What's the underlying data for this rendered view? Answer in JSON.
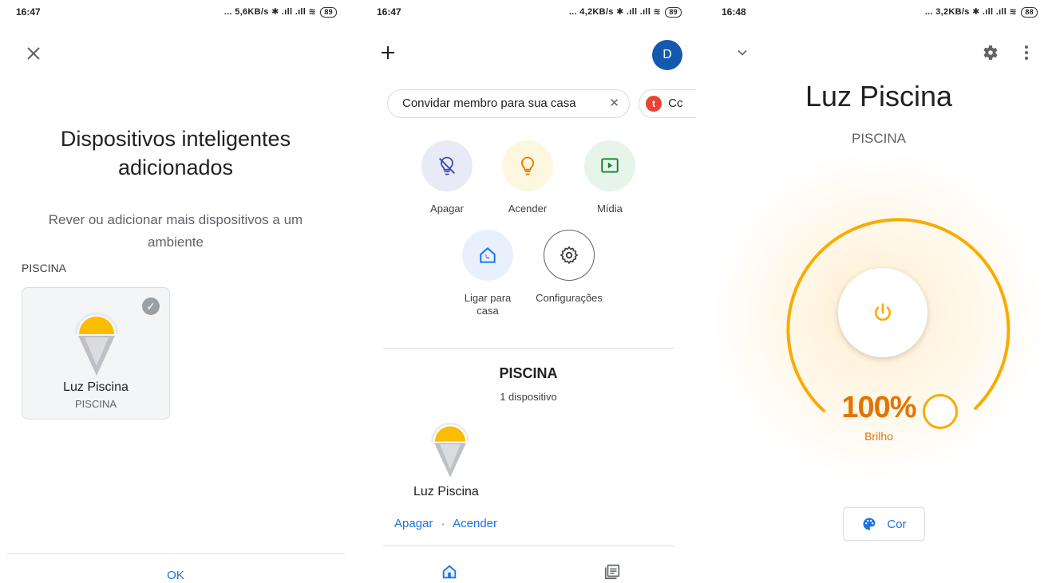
{
  "screen1": {
    "status": {
      "time": "16:47",
      "net": "... 5,6KB/s",
      "battery": "89"
    },
    "title_line1": "Dispositivos inteligentes",
    "title_line2": "adicionados",
    "subtitle_line1": "Rever ou adicionar mais dispositivos a um",
    "subtitle_line2": "ambiente",
    "room_label": "PISCINA",
    "device": {
      "name": "Luz Piscina",
      "room": "PISCINA"
    },
    "ok_label": "OK"
  },
  "screen2": {
    "status": {
      "time": "16:47",
      "net": "... 4,2KB/s",
      "battery": "89"
    },
    "avatar_letter": "D",
    "chip_invite": "Convidar membro para sua casa",
    "chip_partial": "Cc",
    "actions": {
      "off": "Apagar",
      "on": "Acender",
      "media": "Mídia",
      "call_line1": "Ligar para",
      "call_line2": "casa",
      "settings": "Configurações"
    },
    "room_title": "PISCINA",
    "room_count": "1 dispositivo",
    "device_name": "Luz Piscina",
    "link_off": "Apagar",
    "link_sep": "•",
    "link_on": "Acender"
  },
  "screen3": {
    "status": {
      "time": "16:48",
      "net": "... 3,2KB/s",
      "battery": "88"
    },
    "title": "Luz Piscina",
    "room": "PISCINA",
    "brightness": {
      "value": 100,
      "display": "100%",
      "label": "Brilho"
    },
    "color_button": "Cor"
  },
  "colors": {
    "accent_blue": "#1a73e8",
    "brightness_orange": "#e37400",
    "arc_yellow": "#f9ab00",
    "avatar_blue": "#1558b0"
  }
}
